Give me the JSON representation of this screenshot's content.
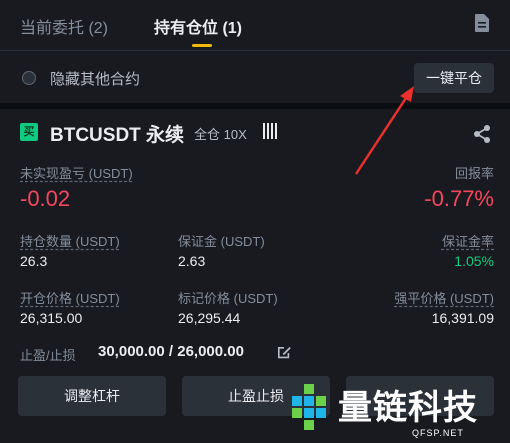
{
  "tabs": {
    "open_orders": "当前委托 (2)",
    "positions": "持有仓位 (1)"
  },
  "hide_other": "隐藏其他合约",
  "close_all_button": "一键平仓",
  "position": {
    "side_badge": "买",
    "symbol": "BTCUSDT 永续",
    "margin_mode": "全仓 10X",
    "unrealized_pnl_label": "未实现盈亏 (USDT)",
    "unrealized_pnl": "-0.02",
    "roe_label": "回报率",
    "roe": "-0.77%",
    "size_label": "持仓数量 (USDT)",
    "size": "26.3",
    "margin_label": "保证金 (USDT)",
    "margin": "2.63",
    "margin_ratio_label": "保证金率",
    "margin_ratio": "1.05%",
    "entry_price_label": "开仓价格 (USDT)",
    "entry_price": "26,315.00",
    "mark_price_label": "标记价格 (USDT)",
    "mark_price": "26,295.44",
    "liq_price_label": "强平价格 (USDT)",
    "liq_price": "16,391.09",
    "tpsl_label": "止盈/止损",
    "tpsl_value": "30,000.00 / 26,000.00"
  },
  "actions": {
    "adjust_leverage": "调整杠杆",
    "tpsl": "止盈止损"
  },
  "watermark": {
    "name": "量链科技",
    "site": "QFSP.NET"
  },
  "colors": {
    "accent": "#f0b90b",
    "negative": "#f6465d",
    "positive": "#0ecb81",
    "background": "#181a20"
  }
}
